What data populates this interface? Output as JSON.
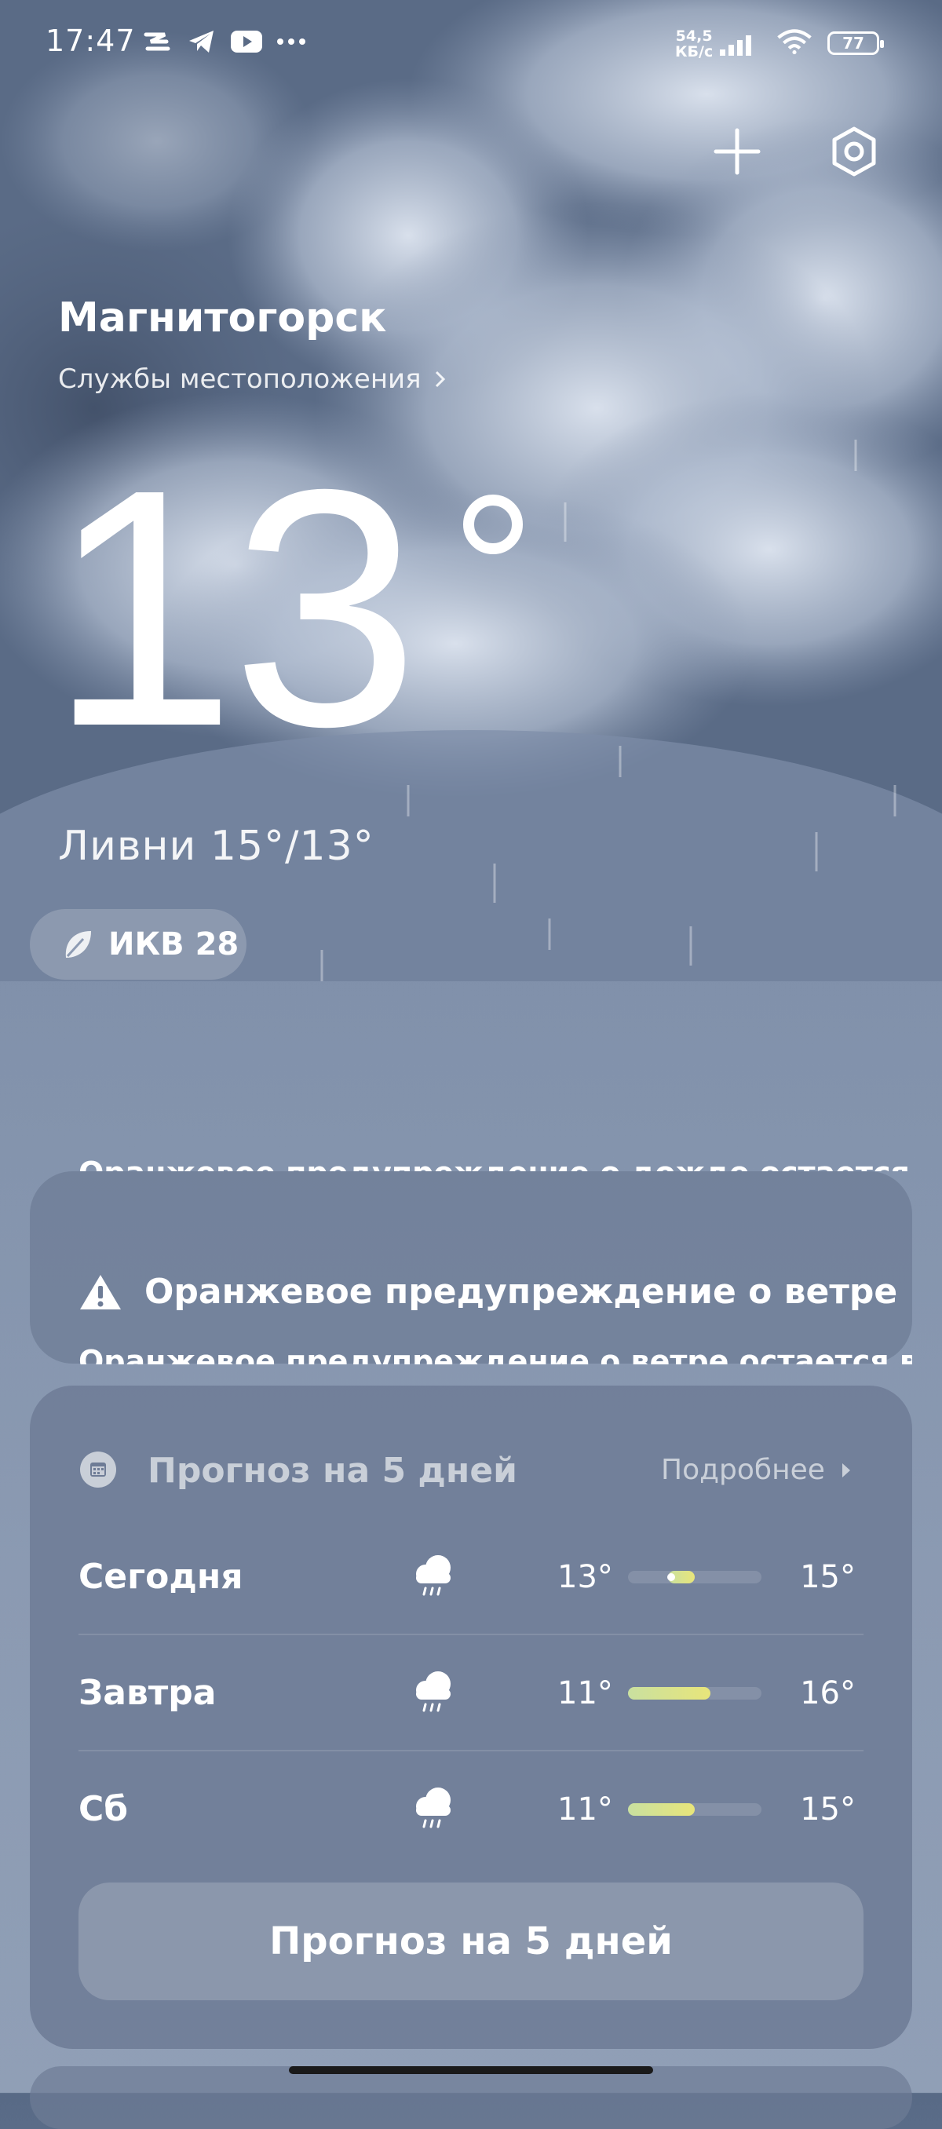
{
  "status_bar": {
    "time": "17:47",
    "net_speed_value": "54,5",
    "net_speed_unit": "КБ/с",
    "battery": "77"
  },
  "header": {
    "city": "Магнитогорск",
    "location_services": "Службы местоположения"
  },
  "current": {
    "temperature": "13",
    "condition": "Ливни  15°/13°",
    "aqi": "ИКВ 28"
  },
  "alerts": {
    "previous_text": "Оранжевое предупреждение о дожде остается...",
    "title": "Оранжевое предупреждение о ветре",
    "text": "Оранжевое предупреждение о ветре остается в"
  },
  "forecast": {
    "title": "Прогноз на 5 дней",
    "more_label": "Подробнее",
    "button_label": "Прогноз на 5 дней",
    "days": [
      {
        "day": "Сегодня",
        "icon": "rain-cloud-icon",
        "min": "13°",
        "max": "15°",
        "bar_start": 0.3,
        "bar_end": 0.5,
        "current_marker": 0.32
      },
      {
        "day": "Завтра",
        "icon": "rain-cloud-icon",
        "min": "11°",
        "max": "16°",
        "bar_start": 0.0,
        "bar_end": 0.62
      },
      {
        "day": "Сб",
        "icon": "rain-cloud-icon",
        "min": "11°",
        "max": "15°",
        "bar_start": 0.0,
        "bar_end": 0.5
      }
    ]
  },
  "colors": {
    "sky_dark": "#586a86",
    "sky_light": "#909fb6",
    "temp_bar_start": "#c9e0a0",
    "temp_bar_end": "#e8e57a"
  }
}
